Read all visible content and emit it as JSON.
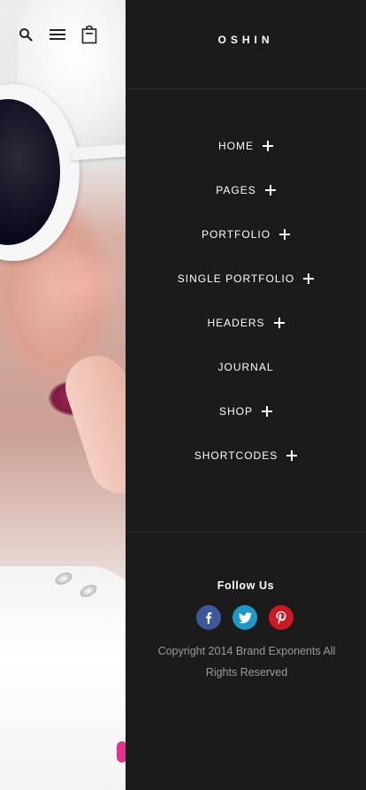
{
  "brand": {
    "logo": "OSHIN"
  },
  "header_icons": {
    "search": "search-icon",
    "menu": "hamburger-icon",
    "cart": "shopping-bag-icon"
  },
  "menu": {
    "items": [
      {
        "label": "HOME",
        "expandable": true
      },
      {
        "label": "PAGES",
        "expandable": true
      },
      {
        "label": "PORTFOLIO",
        "expandable": true
      },
      {
        "label": "SINGLE PORTFOLIO",
        "expandable": true
      },
      {
        "label": "HEADERS",
        "expandable": true
      },
      {
        "label": "JOURNAL",
        "expandable": false
      },
      {
        "label": "SHOP",
        "expandable": true
      },
      {
        "label": "SHORTCODES",
        "expandable": true
      }
    ]
  },
  "footer": {
    "follow_label": "Follow Us",
    "socials": [
      {
        "icon": "facebook-icon",
        "glyph": "f",
        "color": "#3b5998"
      },
      {
        "icon": "twitter-icon",
        "glyph": "t",
        "color": "#1f97c7"
      },
      {
        "icon": "pinterest-icon",
        "glyph": "p",
        "color": "#cb1a24"
      }
    ],
    "copyright": "Copyright 2014 Brand Exponents All Rights Reserved"
  },
  "colors": {
    "panel_bg": "#1b1b1b",
    "text": "#ffffff",
    "muted": "#9b9b9b"
  }
}
